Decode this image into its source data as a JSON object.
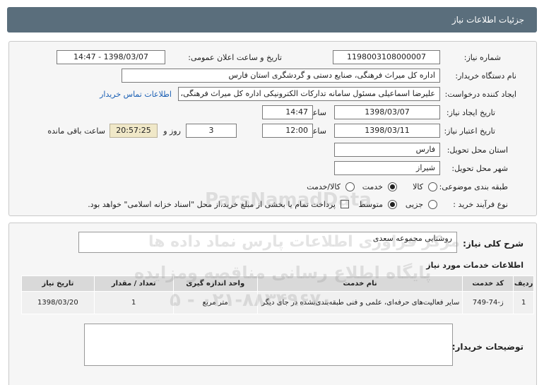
{
  "header": {
    "title": "جزئیات اطلاعات نیاز"
  },
  "form": {
    "need_number_label": "شماره نیاز:",
    "need_number": "1198003108000007",
    "announce_label": "تاریخ و ساعت اعلان عمومی:",
    "announce_value": "1398/03/07 - 14:47",
    "buyer_org_label": "نام دستگاه خریدار:",
    "buyer_org": "اداره کل میراث فرهنگی، صنایع دستی و گردشگری استان فارس",
    "creator_label": "ایجاد کننده درخواست:",
    "creator": "علیرضا اسماعیلی مسئول سامانه تدارکات الکترونیکی اداره کل میراث فرهنگی، صنایع",
    "contact_link": "اطلاعات تماس خریدار",
    "created_date_label": "تاریخ ایجاد نیاز:",
    "created_date": "1398/03/07",
    "time_label": "ساعت",
    "created_time": "14:47",
    "validity_label": "تاریخ اعتبار نیاز:",
    "validity_date": "1398/03/11",
    "validity_time": "12:00",
    "days_label": "روز و",
    "days": "3",
    "remaining_time": "20:57:25",
    "remaining_label": "ساعت باقی مانده",
    "province_label": "استان محل تحویل:",
    "province": "فارس",
    "city_label": "شهر محل تحویل:",
    "city": "شیراز",
    "category_label": "طبقه بندی موضوعی:",
    "category_options": [
      "کالا",
      "خدمت",
      "کالا/خدمت"
    ],
    "category_selected": "خدمت",
    "process_label": "نوع فرآیند خرید :",
    "process_options": [
      "جزیی",
      "متوسط"
    ],
    "process_selected": "متوسط",
    "payment_note": "پرداخت تمام یا بخشی از مبلغ خرید،از محل \"اسناد خزانه اسلامی\" خواهد بود."
  },
  "details": {
    "summary_label": "شرح کلی نیاز:",
    "summary": "روشنایی مجموعه سعدی",
    "services_title": "اطلاعات خدمات مورد نیاز",
    "table": {
      "headers": [
        "ردیف",
        "کد خدمت",
        "نام خدمت",
        "واحد اندازه گیری",
        "تعداد / مقدار",
        "تاریخ نیاز"
      ],
      "rows": [
        [
          "1",
          "ز-74-749",
          "سایر فعالیت‌های حرفه‌ای، علمی و فنی طبقه‌بندی‌نشده در جای دیگر",
          "متر مربع",
          "1",
          "1398/03/20"
        ]
      ]
    },
    "buyer_notes_label": "توضیحات خریدار:",
    "buyer_notes": ""
  },
  "watermarks": [
    "ParsNamadData",
    "مرکز فراوری اطلاعات پارس نماد داده ها",
    "پایگاه اطلاع رسانی مناقصه ومزایده",
    "۰۲۱-۸۸۳۴۹۶۷۰ - ۵"
  ],
  "colors": {
    "header_bg": "#5a6e7c",
    "link": "#1a5fb4",
    "remaining_bg": "#f0e8c8"
  }
}
